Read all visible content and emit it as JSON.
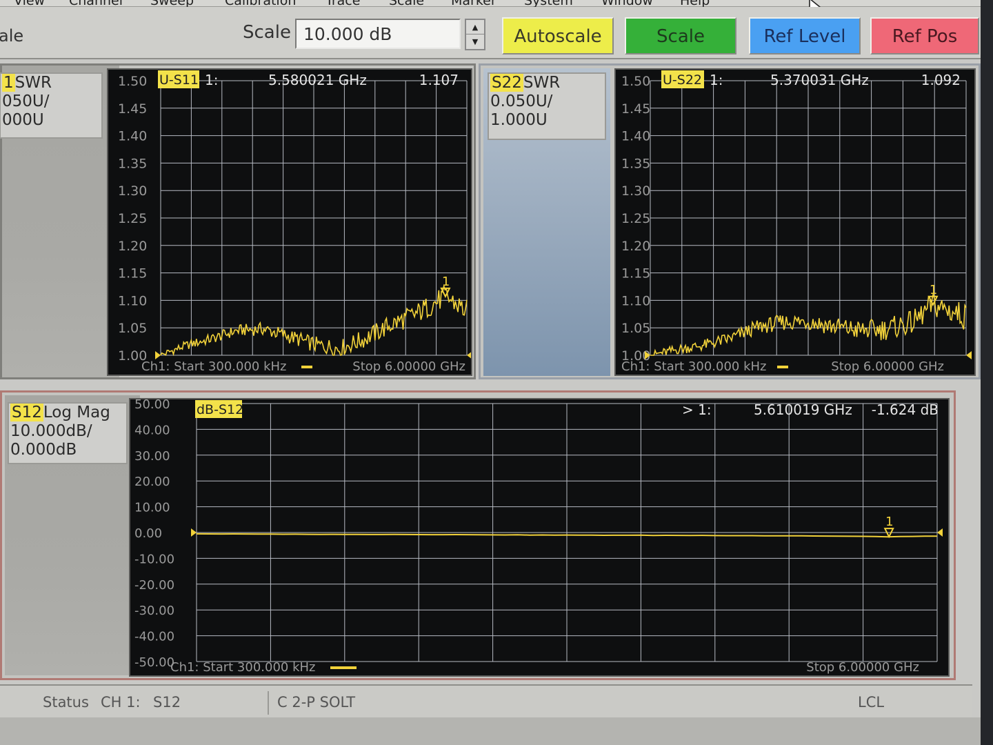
{
  "menu": {
    "items": [
      "View",
      "Channel",
      "Sweep",
      "Calibration",
      "Trace",
      "Scale",
      "Marker",
      "System",
      "Window",
      "Help"
    ]
  },
  "toolbar": {
    "left_label": "ale",
    "scale_label": "Scale",
    "scale_value": "10.000 dB",
    "autoscale_label": "Autoscale",
    "scale_button_label": "Scale",
    "ref_level_label": "Ref Level",
    "ref_pos_label": "Ref Pos",
    "colors": {
      "autoscale": "#eded4a",
      "scale": "#35b039",
      "ref_level": "#4aa0f2",
      "ref_pos": "#ef6877",
      "trace": "#f2d23a"
    }
  },
  "s11": {
    "param_tag": "1",
    "param_format": "SWR",
    "param_scale": "050U/",
    "param_ref": "000U",
    "trace_label": "U-S11",
    "marker_label": "1:",
    "marker_freq": "5.580021 GHz",
    "marker_value": "1.107",
    "start_label": "Ch1: Start  300.000 kHz",
    "stop_label": "Stop  6.00000 GHz",
    "marker_num": "1"
  },
  "s22": {
    "param_tag": "S22",
    "param_format": "SWR",
    "param_scale": "0.050U/",
    "param_ref": "1.000U",
    "trace_label": "U-S22",
    "marker_label": "1:",
    "marker_freq": "5.370031 GHz",
    "marker_value": "1.092",
    "start_label": "Ch1: Start  300.000 kHz",
    "stop_label": "Stop  6.00000 GHz",
    "marker_num": "1"
  },
  "s12": {
    "param_tag": "S12",
    "param_format": "Log Mag",
    "param_scale": "10.000dB/",
    "param_ref": "0.000dB",
    "trace_label": "dB-S12",
    "marker_label": "> 1:",
    "marker_freq": "5.610019 GHz",
    "marker_value": "-1.624 dB",
    "start_label": "Ch1: Start  300.000 kHz",
    "stop_label": "Stop  6.00000 GHz",
    "marker_num": "1"
  },
  "status": {
    "label": "Status",
    "channel": "CH 1:",
    "param": "S12",
    "cal": "C  2-P SOLT",
    "mode": "LCL"
  },
  "chart_data": [
    {
      "type": "line",
      "series": [
        {
          "name": "U-S11",
          "x": [
            0.0003,
            0.5,
            1.0,
            1.5,
            2.0,
            2.5,
            3.0,
            3.5,
            4.0,
            4.5,
            5.0,
            5.58,
            6.0
          ],
          "y": [
            1.0,
            1.018,
            1.03,
            1.045,
            1.048,
            1.035,
            1.02,
            1.012,
            1.03,
            1.055,
            1.075,
            1.107,
            1.08
          ]
        }
      ],
      "xlim": [
        0.0003,
        6.0
      ],
      "ylim": [
        1.0,
        1.5
      ],
      "yticks": [
        "1.50",
        "1.45",
        "1.40",
        "1.35",
        "1.30",
        "1.25",
        "1.20",
        "1.15",
        "1.10",
        "1.05",
        "1.00"
      ],
      "grid": true,
      "markers": [
        {
          "label": "1",
          "x": 5.58,
          "y": 1.107
        }
      ]
    },
    {
      "type": "line",
      "series": [
        {
          "name": "U-S22",
          "x": [
            0.0003,
            0.5,
            1.0,
            1.5,
            2.0,
            2.5,
            3.0,
            3.5,
            4.0,
            4.5,
            5.0,
            5.37,
            6.0
          ],
          "y": [
            1.0,
            1.01,
            1.018,
            1.03,
            1.05,
            1.06,
            1.062,
            1.052,
            1.045,
            1.048,
            1.06,
            1.092,
            1.07
          ]
        }
      ],
      "xlim": [
        0.0003,
        6.0
      ],
      "ylim": [
        1.0,
        1.5
      ],
      "yticks": [
        "1.50",
        "1.45",
        "1.40",
        "1.35",
        "1.30",
        "1.25",
        "1.20",
        "1.15",
        "1.10",
        "1.05",
        "1.00"
      ],
      "grid": true,
      "markers": [
        {
          "label": "1",
          "x": 5.37,
          "y": 1.092
        }
      ]
    },
    {
      "type": "line",
      "series": [
        {
          "name": "dB-S12",
          "x": [
            0.0003,
            1.0,
            2.0,
            3.0,
            4.0,
            5.0,
            5.61,
            6.0
          ],
          "y": [
            -0.5,
            -0.7,
            -0.8,
            -1.0,
            -1.1,
            -1.3,
            -1.624,
            -1.4
          ]
        }
      ],
      "xlim": [
        0.0003,
        6.0
      ],
      "ylim": [
        -50,
        50
      ],
      "yticks": [
        "50.00",
        "40.00",
        "30.00",
        "20.00",
        "10.00",
        "0.00",
        "-10.00",
        "-20.00",
        "-30.00",
        "-40.00",
        "-50.00"
      ],
      "grid": true,
      "markers": [
        {
          "label": "1",
          "x": 5.61,
          "y": -1.624
        }
      ]
    }
  ]
}
